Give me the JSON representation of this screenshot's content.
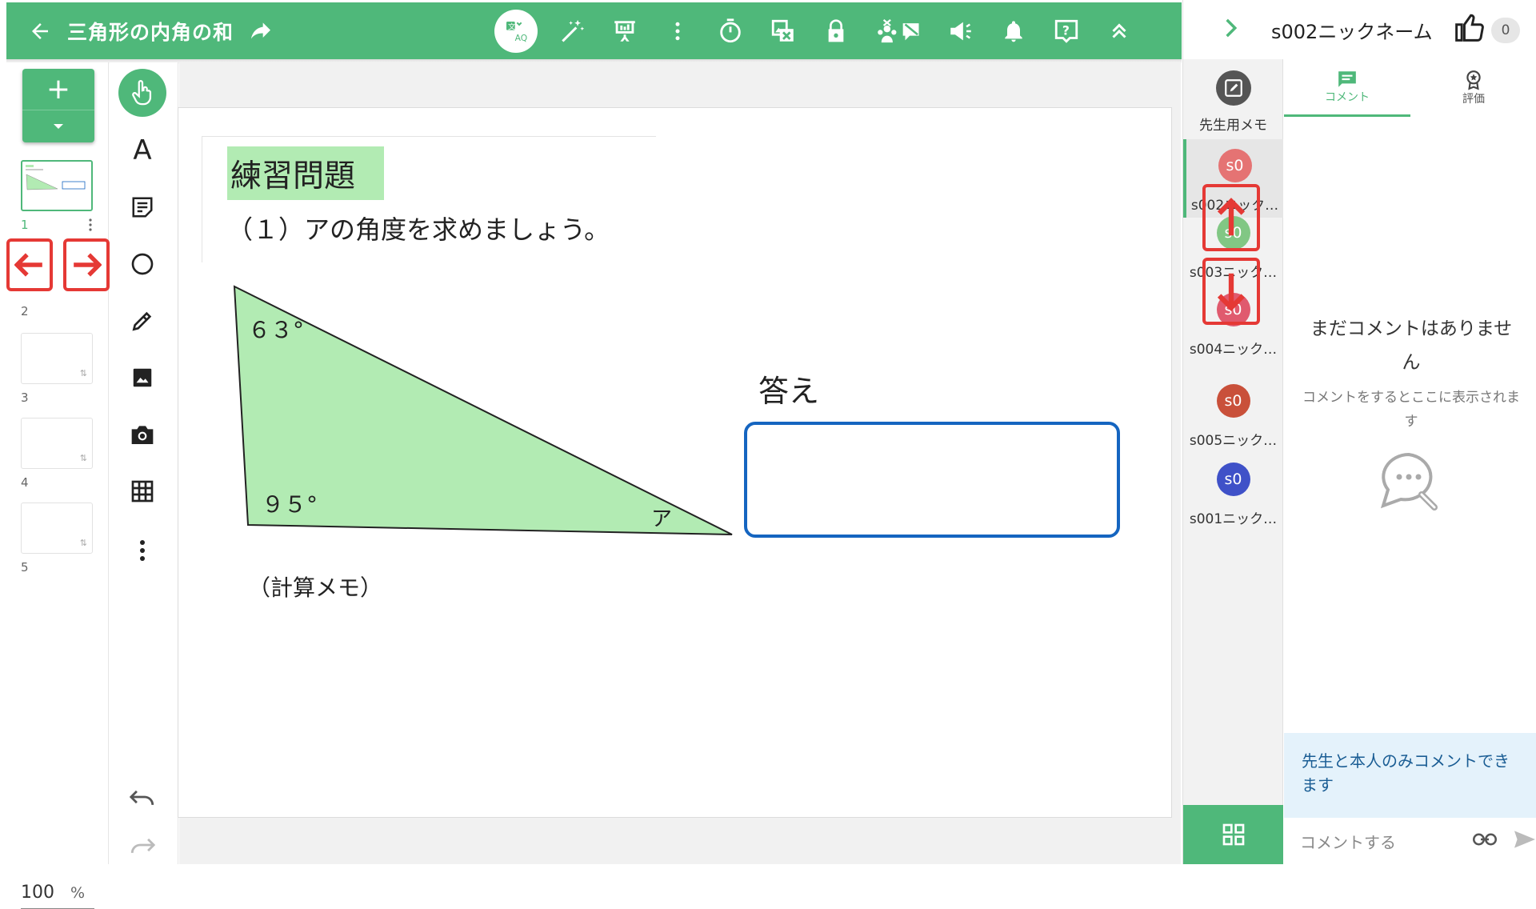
{
  "topbar": {
    "title": "三角形の内角の和",
    "color": "#4fb87a",
    "icons": [
      "back-arrow-icon",
      "share-icon",
      "translate-icon",
      "magic-wand-icon",
      "presentation-icon",
      "more-vert-icon",
      "timer-icon",
      "image-off-icon",
      "lock-icon",
      "group-icon",
      "announce-icon",
      "bell-icon",
      "help-icon",
      "collapse-icon"
    ]
  },
  "pages": {
    "add_icon": "+",
    "items": [
      {
        "num": "1",
        "active": true
      },
      {
        "num": "2"
      },
      {
        "num": "3"
      },
      {
        "num": "4"
      },
      {
        "num": "5"
      }
    ]
  },
  "zoom": {
    "value": "100",
    "unit": "%"
  },
  "tools": [
    "pointer-icon",
    "text-icon",
    "sticky-note-icon",
    "shape-icon",
    "pen-icon",
    "image-icon",
    "camera-icon",
    "table-icon",
    "more-vert-icon",
    "undo-icon",
    "redo-icon"
  ],
  "tool_text_glyph": "A",
  "canvas": {
    "heading": "練習問題",
    "question": "（１）アの角度を求めましょう。",
    "angle_top": "６３°",
    "angle_bottom": "９５°",
    "angle_unknown": "ア",
    "answer_label": "答え",
    "memo_label": "（計算メモ）"
  },
  "right_panel": {
    "student_name": "s002ニックネーム",
    "like_count": "0",
    "teacher_memo": "先生用メモ",
    "students": [
      {
        "avatar": "s0",
        "name": "s002ニック…",
        "color": "#e57373",
        "active": true
      },
      {
        "avatar": "s0",
        "name": "s003ニック…",
        "color": "#81c784"
      },
      {
        "avatar": "s0",
        "name": "s004ニック…",
        "color": "#e05a6e"
      },
      {
        "avatar": "s0",
        "name": "s005ニック…",
        "color": "#c9503a"
      },
      {
        "avatar": "s0",
        "name": "s001ニック…",
        "color": "#3f51c8"
      }
    ],
    "tabs": {
      "comment": "コメント",
      "evaluation": "評価"
    },
    "empty_title": "まだコメントはありません",
    "empty_sub": "コメントをするとここに表示されます",
    "notice": "先生と本人のみコメントできます",
    "comment_placeholder": "コメントする"
  }
}
